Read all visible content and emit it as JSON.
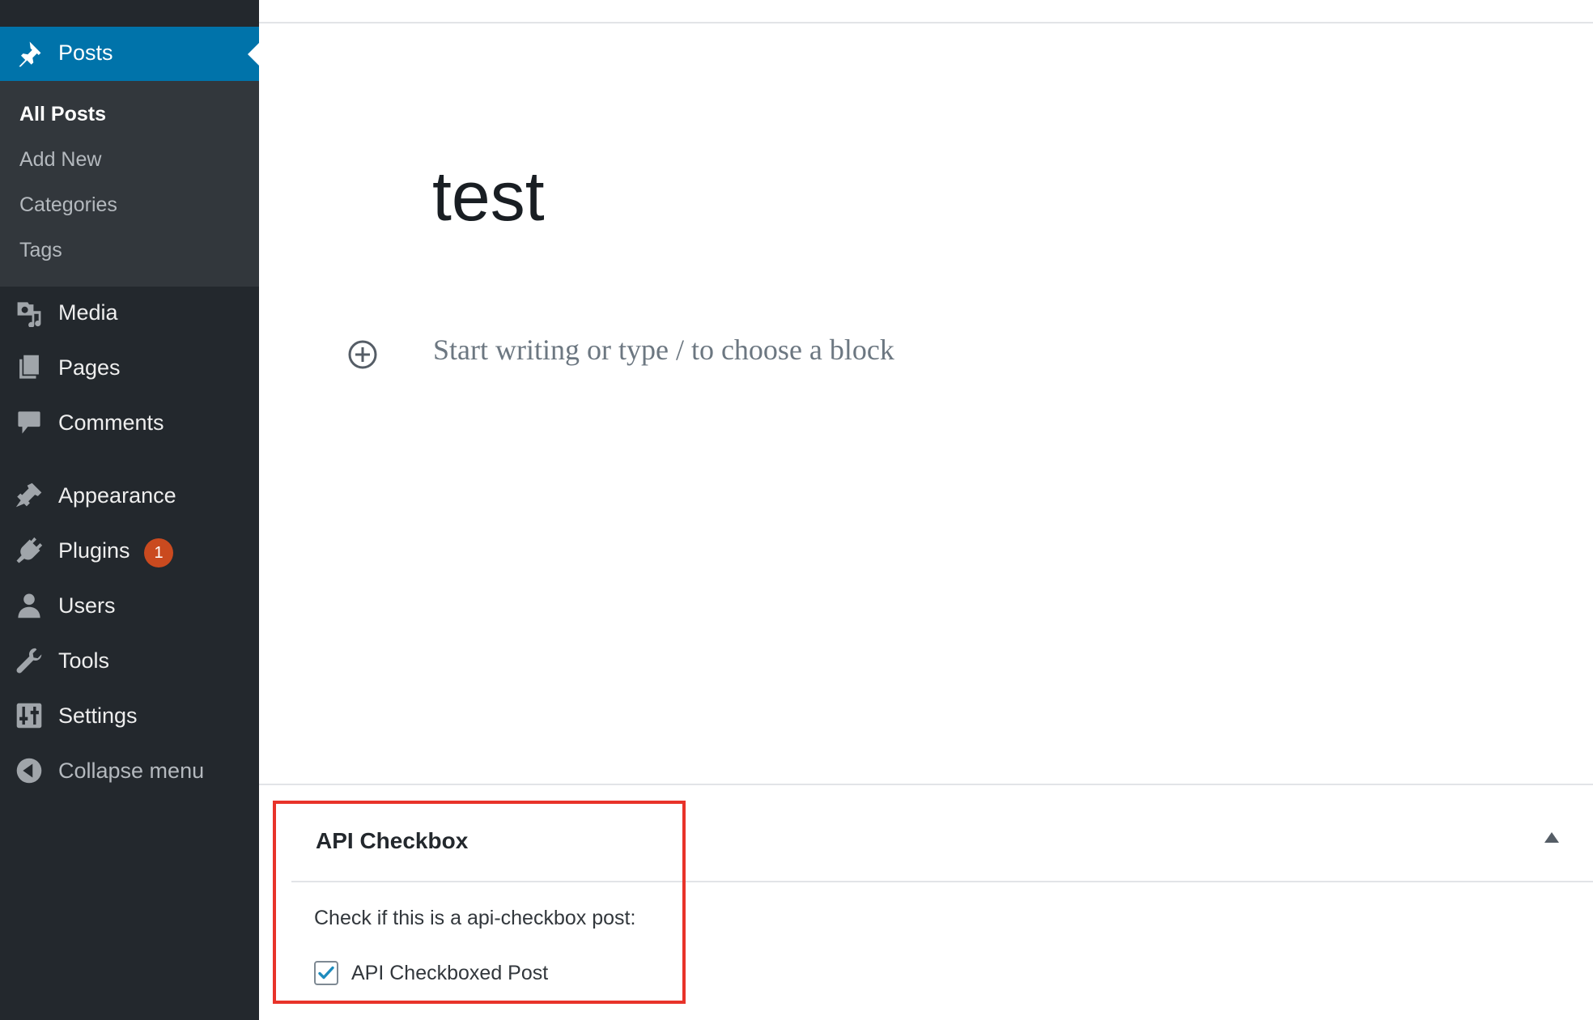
{
  "sidebar": {
    "active_item": {
      "label": "Posts",
      "icon": "pushpin-icon"
    },
    "submenu": [
      {
        "label": "All Posts",
        "current": true
      },
      {
        "label": "Add New",
        "current": false
      },
      {
        "label": "Categories",
        "current": false
      },
      {
        "label": "Tags",
        "current": false
      }
    ],
    "items": [
      {
        "label": "Media",
        "icon": "media-icon"
      },
      {
        "label": "Pages",
        "icon": "pages-icon"
      },
      {
        "label": "Comments",
        "icon": "comment-icon"
      },
      {
        "label": "Appearance",
        "icon": "paintbrush-icon"
      },
      {
        "label": "Plugins",
        "icon": "plug-icon",
        "badge": "1"
      },
      {
        "label": "Users",
        "icon": "user-icon"
      },
      {
        "label": "Tools",
        "icon": "wrench-icon"
      },
      {
        "label": "Settings",
        "icon": "sliders-icon"
      },
      {
        "label": "Collapse menu",
        "icon": "collapse-arrow-icon"
      }
    ]
  },
  "editor": {
    "post_title": "test",
    "block_placeholder": "Start writing or type / to choose a block"
  },
  "meta_box": {
    "title": "API Checkbox",
    "description": "Check if this is a api-checkbox post:",
    "checkbox_label": "API Checkboxed Post",
    "checkbox_checked": true
  },
  "colors": {
    "sidebar_bg": "#23282d",
    "submenu_bg": "#32373c",
    "active_bg": "#0073aa",
    "badge": "#ca4a1f",
    "highlight": "#e8332a",
    "checkmark": "#1e8cbe"
  }
}
